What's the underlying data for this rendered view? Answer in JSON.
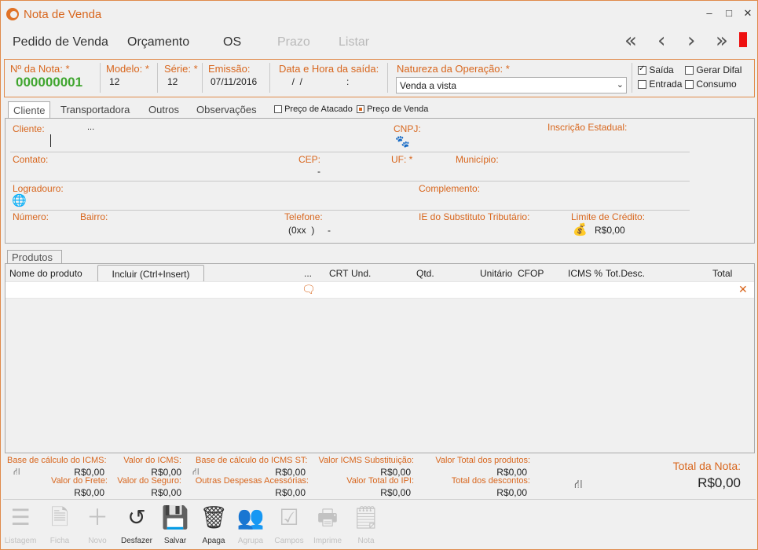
{
  "window": {
    "title": "Nota de Venda"
  },
  "menu": {
    "pedido": "Pedido de Venda",
    "orcamento": "Orçamento",
    "os": "OS",
    "prazo": "Prazo",
    "listar": "Listar"
  },
  "nav": {
    "first": "«",
    "prev": "‹",
    "next": "›",
    "last": "»"
  },
  "header": {
    "nota_label": "Nº da Nota: *",
    "nota_value": "000000001",
    "modelo_label": "Modelo: *",
    "modelo_value": "12",
    "serie_label": "Série: *",
    "serie_value": "12",
    "emissao_label": "Emissão:",
    "emissao_value": "07/11/2016",
    "saida_label": "Data e Hora da saída:",
    "saida_value": "  /  /",
    "saida_time": ":",
    "natureza_label": "Natureza da Operação: *",
    "natureza_value": "Venda a vista",
    "checks": {
      "saida": "Saída",
      "entrada": "Entrada",
      "gerar_difal": "Gerar Difal",
      "consumo": "Consumo"
    }
  },
  "tabs": {
    "cliente": "Cliente",
    "transportadora": "Transportadora",
    "outros": "Outros",
    "observacoes": "Observações"
  },
  "preco": {
    "atacado": "Preço de Atacado",
    "venda": "Preço de Venda"
  },
  "cliente": {
    "cliente_label": "Cliente:",
    "ellipsis": "...",
    "cnpj_label": "CNPJ:",
    "ie_label": "Inscrição Estadual:",
    "contato_label": "Contato:",
    "cep_label": "CEP:",
    "cep_value": "-",
    "uf_label": "UF: *",
    "municipio_label": "Município:",
    "logradouro_label": "Logradouro:",
    "complemento_label": "Complemento:",
    "numero_label": "Número:",
    "bairro_label": "Bairro:",
    "telefone_label": "Telefone:",
    "telefone_value": "(0xx  )     -",
    "ie_st_label": "IE do Substituto Tributário:",
    "limite_label": "Limite de Crédito:",
    "limite_value": "R$0,00"
  },
  "produtos": {
    "tab": "Produtos",
    "columns": {
      "nome": "Nome do produto",
      "incluir": "Incluir (Ctrl+Insert)",
      "dots": "...",
      "crt": "CRT",
      "und": "Und.",
      "qtd": "Qtd.",
      "unitario": "Unitário",
      "cfop": "CFOP",
      "icms": "ICMS %",
      "totdesc": "Tot.Desc.",
      "total": "Total"
    }
  },
  "totais": {
    "base_icms_label": "Base de cálculo do ICMS:",
    "base_icms_value": "R$0,00",
    "valor_icms_label": "Valor do ICMS:",
    "valor_icms_value": "R$0,00",
    "base_icms_st_label": "Base de cálculo do ICMS ST:",
    "base_icms_st_value": "R$0,00",
    "valor_icms_sub_label": "Valor ICMS Substituição:",
    "valor_icms_sub_value": "R$0,00",
    "valor_total_prod_label": "Valor Total dos produtos:",
    "valor_total_prod_value": "R$0,00",
    "valor_frete_label": "Valor do Frete:",
    "valor_frete_value": "R$0,00",
    "valor_seguro_label": "Valor do Seguro:",
    "valor_seguro_value": "R$0,00",
    "outras_label": "Outras Despesas Acessórias:",
    "outras_value": "R$0,00",
    "valor_ipi_label": "Valor Total do IPI:",
    "valor_ipi_value": "R$0,00",
    "total_desc_label": "Total dos descontos:",
    "total_desc_value": "R$0,00",
    "total_nota_label": "Total da Nota:",
    "total_nota_value": "R$0,00"
  },
  "toolbar": {
    "listagem": "Listagem",
    "ficha": "Ficha",
    "novo": "Novo",
    "desfazer": "Desfazer",
    "salvar": "Salvar",
    "apaga": "Apaga",
    "agrupa": "Agrupa",
    "campos": "Campos",
    "imprime": "Imprime",
    "nota": "Nota"
  },
  "colors": {
    "accent": "#d8661d",
    "nota_number": "#3fa52e",
    "close_red": "#e11111"
  }
}
